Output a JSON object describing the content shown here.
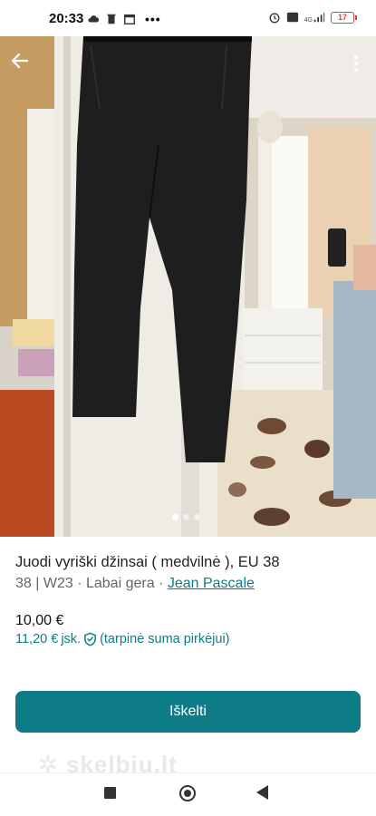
{
  "status_bar": {
    "time": "20:33",
    "battery_level": "17",
    "network": "4G",
    "left_icons": [
      "cloud-icon",
      "trash-icon",
      "calendar-icon",
      "more-dots-icon"
    ],
    "right_icons": [
      "alarm-icon",
      "volte-icon",
      "signal-icon",
      "battery-icon"
    ]
  },
  "listing": {
    "title": "Juodi vyriški džinsai ( medvilnė ), EU 38",
    "size": "38 | W23",
    "separator": "·",
    "condition": "Labai gera",
    "brand": "Jean Pascale",
    "price": "10,00 €",
    "price_with_fee": "11,20 €",
    "price_fee_suffix": "jsk.",
    "price_fee_note": "(tarpinė suma pirkėjui)"
  },
  "carousel": {
    "count": 3,
    "active_index": 0
  },
  "actions": {
    "boost_label": "Iškelti"
  },
  "footer": {
    "watermark": "skelbiu.lt"
  },
  "colors": {
    "accent": "#0e7c86",
    "battery": "#e23b3b"
  }
}
